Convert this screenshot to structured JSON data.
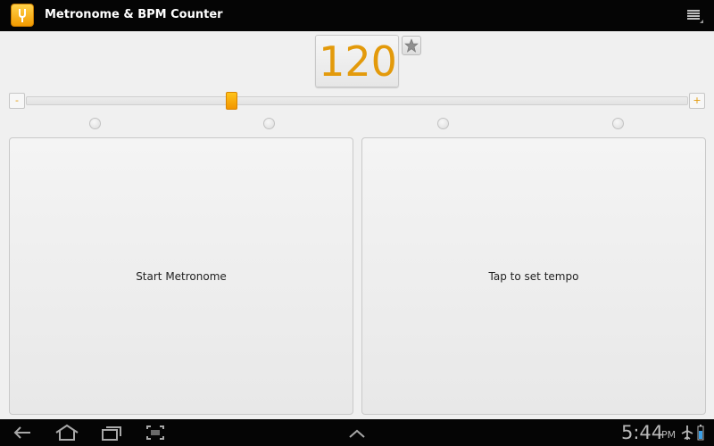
{
  "app": {
    "title": "Metronome & BPM Counter",
    "icon": "tuning-fork-icon",
    "menu_icon": "overflow-menu-icon"
  },
  "bpm": {
    "value": "120",
    "favorite_icon": "star-icon"
  },
  "slider": {
    "minus_label": "-",
    "plus_label": "+",
    "level": 0.31
  },
  "beats": {
    "count": 4,
    "active": 0
  },
  "buttons": {
    "start": "Start Metronome",
    "tap": "Tap to set tempo"
  },
  "status": {
    "time": "5:44",
    "ampm": "PM",
    "icons": [
      "back-icon",
      "home-icon",
      "recent-apps-icon",
      "screenshot-icon",
      "up-chevron-icon",
      "airplane-icon",
      "battery-icon"
    ]
  },
  "colors": {
    "accent": "#e39a0b",
    "bar": "#050505",
    "background": "#f0f0f0"
  }
}
